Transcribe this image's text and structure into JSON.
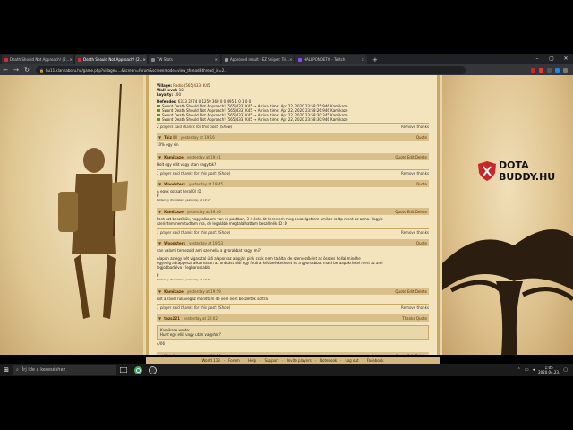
{
  "browser": {
    "tabs": [
      {
        "title": "Death Should Not Approach! (2...",
        "icon_color": "#d32f2f",
        "active": false
      },
      {
        "title": "Death Should Not Approach! (2...",
        "icon_color": "#d32f2f",
        "active": true
      },
      {
        "title": "TW Stats",
        "icon_color": "#888888",
        "active": false
      },
      {
        "title": "Approved result - EZ Sniper: Tri...",
        "icon_color": "#9e9e9e",
        "active": false
      },
      {
        "title": "HALLPONDETO - Twitch",
        "icon_color": "#9146ff",
        "active": false
      }
    ],
    "new_tab": "+",
    "window_controls": [
      "–",
      "▢",
      "✕"
    ],
    "url": "hu11.klanhaboru.hu/game.php?village=...&screen=forum&screenmode=view_thread&thread_id=2...",
    "nav": {
      "back": "←",
      "forward": "→",
      "reload": "↻"
    }
  },
  "forum": {
    "report": {
      "village_label": "Village:",
      "village_value": "Radio (565|433) K45",
      "wall_label": "Wall level:",
      "wall_value": "10",
      "loyalty_label": "Loyalty:",
      "loyalty_value": "100",
      "defender_label": "Defender:",
      "defender_value": "6333 2974 0 1259 360 0 0 495 1 0 1 0 0",
      "lines": [
        "Sword Death Should Not Approach! (565|433) K45 → Arrival time: Apr 22, 2020 23:58:25:946 Kamikaze",
        "Sword Death Should Not Approach! (565|433) K45 → Arrival time: Apr 22, 2020 23:58:26:946 Kamikaze",
        "Sword Death Should Not Approach! (565|433) K45 → Arrival time: Apr 22, 2020 23:58:30:345 Kamikaze",
        "Sword Death Should Not Approach! (565|433) K45 → Arrival time: Apr 22, 2020 23:58:30:946 Kamikaze"
      ]
    },
    "thanks_bars": [
      {
        "text": "2 players said thanks for this post: (Show)",
        "action": "Remove thanks"
      },
      {
        "text": "1 player said thanks for this post: (Show)",
        "action": "Remove thanks"
      },
      {
        "text": "1 player said thanks for this post: (Show)",
        "action": "Remove thanks"
      },
      {
        "text": "1 player said thanks for this post: (Show)",
        "action": "Remove thanks"
      }
    ],
    "posts": [
      {
        "author": "Tuiz III",
        "date": "yesterday at 19:16",
        "actions": "Quote",
        "body": [
          "10% egy sin"
        ]
      },
      {
        "author": "Kamikaze",
        "date": "yesterday at 19:41",
        "actions": "Quote Edit Delete",
        "body": [
          "Holt egy ellit vagy utan vagytok?"
        ]
      },
      {
        "author": "Woodsters",
        "date": "yesterday at 19:45",
        "actions": "Quote",
        "body": [
          "A egyk soksat kerall0l :D",
          "P"
        ],
        "sig": "Edited by Woodsters yesterday at 19:47"
      },
      {
        "author": "Kamikaze",
        "date": "yesterday at 19:46",
        "actions": "Quote Edit Delete",
        "body": [
          "Pont azt beszéltük, hogy alkalom van rá pontban, 3-4 órán át kerestem meg beszélgettem amikor rolltp ment az arma. Vagyis",
          "szerintem nem tudtam rea, de legalább megtalálhattam beszélnék :D :D"
        ]
      },
      {
        "author": "Woodsters",
        "date": "yesterday at 19:53",
        "actions": "Quote",
        "body": [
          "van valami ternezoid ami szemelia a gyarabbat vagyi mi?",
          "",
          "Alapon az egy hét vigasztal ütő alapon az alapján pink csak nem találta, de szervezőként az összes hollal mindhe",
          "egyedig adtappeszt alkalmasan az ordítást alól egy fotóra, két beérkedeset és a gyorsabbat majd beraapokrinkel mert az ami",
          "legjobbadalva - legbarossabb.",
          "",
          "P"
        ],
        "sig": "Edited by Woodsters yesterday at 19:55"
      },
      {
        "author": "Kamikaze",
        "date": "yesterday at 19:59",
        "actions": "Quote Edit Delete",
        "body": [
          "rölt a ravel ruliavegaz mondtam de vele nem beszéltek sortra"
        ]
      },
      {
        "author": "tuzs221",
        "date": "yesterday at 20:02",
        "actions": "Thanks Quote",
        "body": [],
        "quote": {
          "title": "Kamikaze wrote:",
          "text": "Hunt egy ellit vagy utan vagytok?"
        },
        "after": "4/06"
      },
      {
        "author": "Kamikaze",
        "date": "yesterday at 20:16",
        "actions": "Quote Edit Delete",
        "body": []
      }
    ]
  },
  "game_nav": [
    "World 113",
    "Forum",
    "Help",
    "Support",
    "Invite players",
    "Notebook",
    "Log out",
    "Facebook"
  ],
  "logo": {
    "line1": "DOTA",
    "line2": "BUDDY.HU",
    "color": "#c62828"
  },
  "taskbar": {
    "search_placeholder": "Írj ide a kereséshez",
    "time": "1:05",
    "date": "2020.04.23."
  }
}
